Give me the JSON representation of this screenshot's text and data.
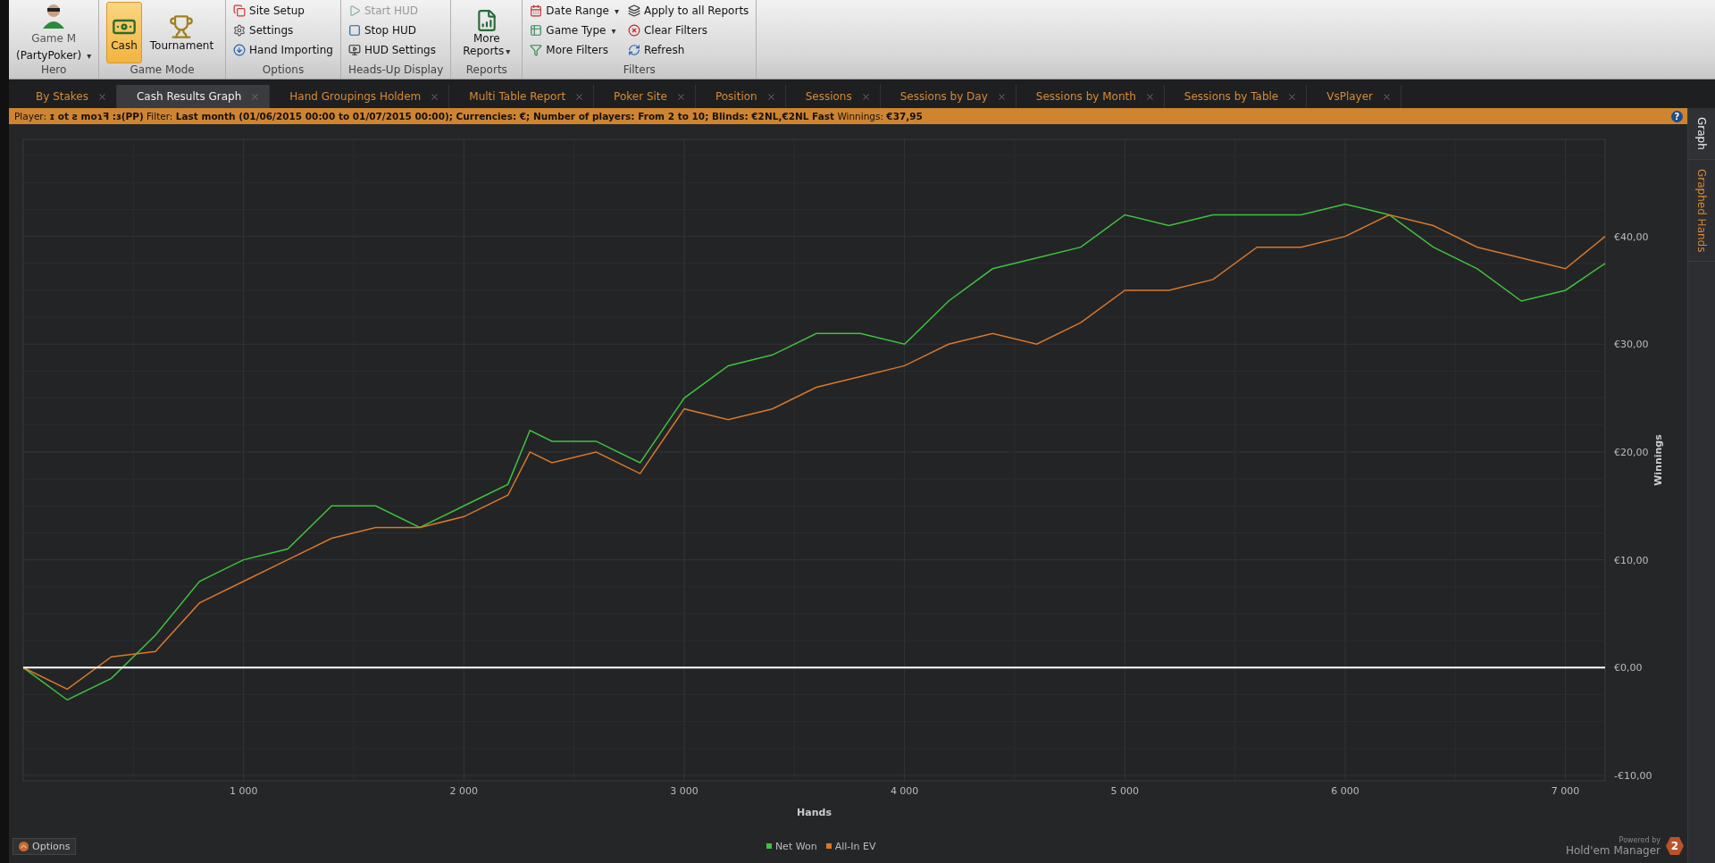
{
  "ribbon": {
    "hero": {
      "label": "Hero",
      "player": "Game M",
      "site": "(PartyPoker)",
      "caret": "▾"
    },
    "game_mode": {
      "label": "Game Mode",
      "modes": [
        {
          "label": "Cash",
          "kind": "cash",
          "selected": true
        },
        {
          "label": "Tournament",
          "kind": "trophy",
          "selected": false
        }
      ]
    },
    "options": {
      "label": "Options",
      "items": [
        {
          "label": "Site Setup",
          "kind": "site"
        },
        {
          "label": "Settings",
          "kind": "gear"
        },
        {
          "label": "Hand Importing",
          "kind": "import"
        }
      ]
    },
    "hud": {
      "label": "Heads-Up Display",
      "items": [
        {
          "label": "Start HUD",
          "kind": "play",
          "disabled": true
        },
        {
          "label": "Stop HUD",
          "kind": "stop",
          "disabled": false
        },
        {
          "label": "HUD Settings",
          "kind": "hud",
          "disabled": false
        }
      ]
    },
    "reports": {
      "label": "Reports",
      "line1": "More",
      "line2": "Reports",
      "caret": "▾"
    },
    "filters": {
      "label": "Filters",
      "items": [
        {
          "label": "Date Range",
          "kind": "calendar",
          "caret": "▾"
        },
        {
          "label": "Game Type",
          "kind": "table",
          "caret": "▾"
        },
        {
          "label": "More Filters",
          "kind": "filter"
        },
        {
          "label": "Apply to all Reports",
          "kind": "apply"
        },
        {
          "label": "Clear Filters",
          "kind": "clear"
        },
        {
          "label": "Refresh",
          "kind": "refresh"
        }
      ]
    }
  },
  "tabs": [
    {
      "label": "By Stakes",
      "selected": false
    },
    {
      "label": "Cash Results Graph",
      "selected": true
    },
    {
      "label": "Hand Groupings Holdem",
      "selected": false
    },
    {
      "label": "Multi Table Report",
      "selected": false
    },
    {
      "label": "Poker Site",
      "selected": false
    },
    {
      "label": "Position",
      "selected": false
    },
    {
      "label": "Sessions",
      "selected": false
    },
    {
      "label": "Sessions by Day",
      "selected": false
    },
    {
      "label": "Sessions by Month",
      "selected": false
    },
    {
      "label": "Sessions by Table",
      "selected": false
    },
    {
      "label": "VsPlayer",
      "selected": false
    }
  ],
  "filter_bar": {
    "text": "Player: **ɪ ot ƨ moɿꟻ :ɜ(PP)**  Filter:  **Last month (01/06/2015 00:00 to 01/07/2015 00:00); Currencies: €; Number of players: From 2 to 10; Blinds: €2NL,€2NL Fast**  Winnings:  **€37,95**",
    "help": "?"
  },
  "chart_data": {
    "type": "line",
    "grid": true,
    "xlabel": "Hands",
    "ylabel": "Winnings",
    "xlim": [
      0,
      7180
    ],
    "ylim": [
      -10.5,
      49
    ],
    "xticks": [
      {
        "value": 1000,
        "label": "1 000"
      },
      {
        "value": 2000,
        "label": "2 000"
      },
      {
        "value": 3000,
        "label": "3 000"
      },
      {
        "value": 4000,
        "label": "4 000"
      },
      {
        "value": 5000,
        "label": "5 000"
      },
      {
        "value": 6000,
        "label": "6 000"
      },
      {
        "value": 7000,
        "label": "7 000"
      }
    ],
    "yticks": [
      {
        "value": -10,
        "label": "-€10,00"
      },
      {
        "value": 0,
        "label": "€0,00"
      },
      {
        "value": 10,
        "label": "€10,00"
      },
      {
        "value": 20,
        "label": "€20,00"
      },
      {
        "value": 30,
        "label": "€30,00"
      },
      {
        "value": 40,
        "label": "€40,00"
      }
    ],
    "x": [
      0,
      200,
      400,
      600,
      800,
      1000,
      1200,
      1400,
      1600,
      1800,
      2000,
      2200,
      2300,
      2400,
      2600,
      2800,
      3000,
      3200,
      3400,
      3600,
      3800,
      4000,
      4200,
      4400,
      4600,
      4800,
      5000,
      5200,
      5400,
      5600,
      5800,
      6000,
      6200,
      6400,
      6600,
      6800,
      7000,
      7180
    ],
    "series": [
      {
        "name": "Net Won",
        "color": "#3cc43c",
        "values": [
          0,
          -3,
          -1,
          3,
          8,
          10,
          11,
          15,
          15,
          13,
          15,
          17,
          22,
          21,
          21,
          19,
          25,
          28,
          29,
          31,
          31,
          30,
          34,
          37,
          38,
          39,
          42,
          41,
          42,
          42,
          42,
          43,
          42,
          39,
          37,
          34,
          35,
          37.5
        ]
      },
      {
        "name": "All-In EV",
        "color": "#d8782a",
        "values": [
          0,
          -2,
          1,
          1.5,
          6,
          8,
          10,
          12,
          13,
          13,
          14,
          16,
          20,
          19,
          20,
          18,
          24,
          23,
          24,
          26,
          27,
          28,
          30,
          31,
          30,
          32,
          35,
          35,
          36,
          39,
          39,
          40,
          42,
          41,
          39,
          38,
          37,
          40
        ]
      }
    ]
  },
  "side_tabs": [
    {
      "label": "Graph",
      "selected": true
    },
    {
      "label": "Graphed Hands",
      "selected": false
    }
  ],
  "footer": {
    "options": "Options",
    "powered_by": "Powered by",
    "brand": "Hold'em Manager",
    "badge": "2"
  }
}
